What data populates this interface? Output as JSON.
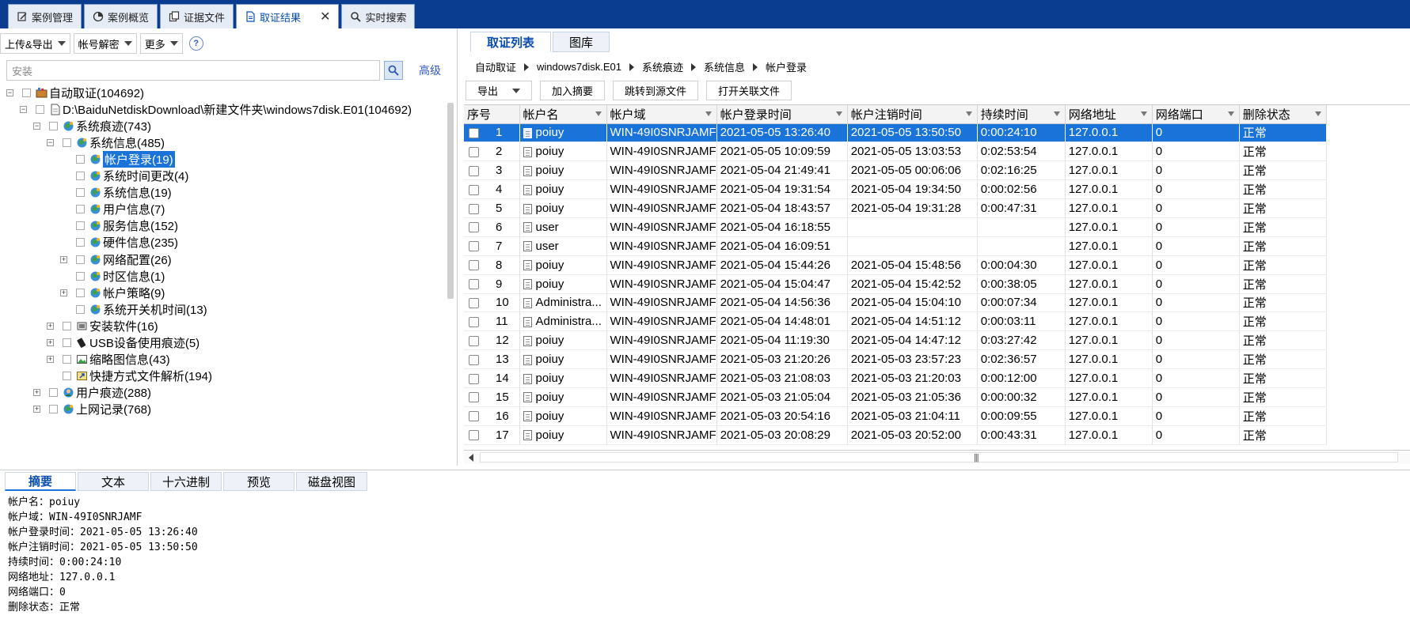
{
  "top_tabs": [
    {
      "label": "案例管理",
      "icon": "edit-icon"
    },
    {
      "label": "案例概览",
      "icon": "pie-chart-icon"
    },
    {
      "label": "证据文件",
      "icon": "copy-icon"
    },
    {
      "label": "取证结果",
      "icon": "document-icon",
      "active": true
    },
    {
      "label": "实时搜索",
      "icon": "search-icon"
    }
  ],
  "left_toolbar": {
    "upload_export": "上传&导出",
    "account_decrypt": "帐号解密",
    "more": "更多",
    "help": "?"
  },
  "search": {
    "placeholder": "安装",
    "advanced": "高级"
  },
  "tree": [
    {
      "label": "自动取证(104692)",
      "indent": 0,
      "exp": "-",
      "icon": "case-icon"
    },
    {
      "label": "D:\\BaiduNetdiskDownload\\新建文件夹\\windows7disk.E01(104692)",
      "indent": 1,
      "exp": "-",
      "icon": "file-icon"
    },
    {
      "label": "系统痕迹(743)",
      "indent": 2,
      "exp": "-",
      "icon": "globe-icon"
    },
    {
      "label": "系统信息(485)",
      "indent": 3,
      "exp": "-",
      "icon": "globe-icon"
    },
    {
      "label": "帐户登录(19)",
      "indent": 4,
      "exp": "",
      "icon": "globe-icon",
      "selected": true
    },
    {
      "label": "系统时间更改(4)",
      "indent": 4,
      "exp": "",
      "icon": "globe-icon"
    },
    {
      "label": "系统信息(19)",
      "indent": 4,
      "exp": "",
      "icon": "globe-icon"
    },
    {
      "label": "用户信息(7)",
      "indent": 4,
      "exp": "",
      "icon": "globe-icon"
    },
    {
      "label": "服务信息(152)",
      "indent": 4,
      "exp": "",
      "icon": "globe-icon"
    },
    {
      "label": "硬件信息(235)",
      "indent": 4,
      "exp": "",
      "icon": "globe-icon"
    },
    {
      "label": "网络配置(26)",
      "indent": 4,
      "exp": "+",
      "icon": "globe-icon"
    },
    {
      "label": "时区信息(1)",
      "indent": 4,
      "exp": "",
      "icon": "globe-icon"
    },
    {
      "label": "帐户策略(9)",
      "indent": 4,
      "exp": "+",
      "icon": "globe-icon"
    },
    {
      "label": "系统开关机时间(13)",
      "indent": 4,
      "exp": "",
      "icon": "globe-icon"
    },
    {
      "label": "安装软件(16)",
      "indent": 3,
      "exp": "+",
      "icon": "software-icon"
    },
    {
      "label": "USB设备使用痕迹(5)",
      "indent": 3,
      "exp": "+",
      "icon": "usb-icon"
    },
    {
      "label": "缩略图信息(43)",
      "indent": 3,
      "exp": "+",
      "icon": "image-icon"
    },
    {
      "label": "快捷方式文件解析(194)",
      "indent": 3,
      "exp": "",
      "icon": "shortcut-icon"
    },
    {
      "label": "用户痕迹(288)",
      "indent": 2,
      "exp": "+",
      "icon": "user-icon"
    },
    {
      "label": "上网记录(768)",
      "indent": 2,
      "exp": "+",
      "icon": "globe-icon"
    }
  ],
  "right_tabs": [
    {
      "label": "取证列表",
      "active": true
    },
    {
      "label": "图库"
    }
  ],
  "breadcrumb": [
    "自动取证",
    "windows7disk.E01",
    "系统痕迹",
    "系统信息",
    "帐户登录"
  ],
  "right_toolbar": {
    "export": "导出",
    "add_summary": "加入摘要",
    "jump_source": "跳转到源文件",
    "open_related": "打开关联文件"
  },
  "columns": [
    "序号",
    "帐户名",
    "帐户域",
    "帐户登录时间",
    "帐户注销时间",
    "持续时间",
    "网络地址",
    "网络端口",
    "删除状态"
  ],
  "rows": [
    [
      "1",
      "poiuy",
      "WIN-49I0SNRJAMF",
      "2021-05-05 13:26:40",
      "2021-05-05 13:50:50",
      "0:00:24:10",
      "127.0.0.1",
      "0",
      "正常"
    ],
    [
      "2",
      "poiuy",
      "WIN-49I0SNRJAMF",
      "2021-05-05 10:09:59",
      "2021-05-05 13:03:53",
      "0:02:53:54",
      "127.0.0.1",
      "0",
      "正常"
    ],
    [
      "3",
      "poiuy",
      "WIN-49I0SNRJAMF",
      "2021-05-04 21:49:41",
      "2021-05-05 00:06:06",
      "0:02:16:25",
      "127.0.0.1",
      "0",
      "正常"
    ],
    [
      "4",
      "poiuy",
      "WIN-49I0SNRJAMF",
      "2021-05-04 19:31:54",
      "2021-05-04 19:34:50",
      "0:00:02:56",
      "127.0.0.1",
      "0",
      "正常"
    ],
    [
      "5",
      "poiuy",
      "WIN-49I0SNRJAMF",
      "2021-05-04 18:43:57",
      "2021-05-04 19:31:28",
      "0:00:47:31",
      "127.0.0.1",
      "0",
      "正常"
    ],
    [
      "6",
      "user",
      "WIN-49I0SNRJAMF",
      "2021-05-04 16:18:55",
      "",
      "",
      "127.0.0.1",
      "0",
      "正常"
    ],
    [
      "7",
      "user",
      "WIN-49I0SNRJAMF",
      "2021-05-04 16:09:51",
      "",
      "",
      "127.0.0.1",
      "0",
      "正常"
    ],
    [
      "8",
      "poiuy",
      "WIN-49I0SNRJAMF",
      "2021-05-04 15:44:26",
      "2021-05-04 15:48:56",
      "0:00:04:30",
      "127.0.0.1",
      "0",
      "正常"
    ],
    [
      "9",
      "poiuy",
      "WIN-49I0SNRJAMF",
      "2021-05-04 15:04:47",
      "2021-05-04 15:42:52",
      "0:00:38:05",
      "127.0.0.1",
      "0",
      "正常"
    ],
    [
      "10",
      "Administra...",
      "WIN-49I0SNRJAMF",
      "2021-05-04 14:56:36",
      "2021-05-04 15:04:10",
      "0:00:07:34",
      "127.0.0.1",
      "0",
      "正常"
    ],
    [
      "11",
      "Administra...",
      "WIN-49I0SNRJAMF",
      "2021-05-04 14:48:01",
      "2021-05-04 14:51:12",
      "0:00:03:11",
      "127.0.0.1",
      "0",
      "正常"
    ],
    [
      "12",
      "poiuy",
      "WIN-49I0SNRJAMF",
      "2021-05-04 11:19:30",
      "2021-05-04 14:47:12",
      "0:03:27:42",
      "127.0.0.1",
      "0",
      "正常"
    ],
    [
      "13",
      "poiuy",
      "WIN-49I0SNRJAMF",
      "2021-05-03 21:20:26",
      "2021-05-03 23:57:23",
      "0:02:36:57",
      "127.0.0.1",
      "0",
      "正常"
    ],
    [
      "14",
      "poiuy",
      "WIN-49I0SNRJAMF",
      "2021-05-03 21:08:03",
      "2021-05-03 21:20:03",
      "0:00:12:00",
      "127.0.0.1",
      "0",
      "正常"
    ],
    [
      "15",
      "poiuy",
      "WIN-49I0SNRJAMF",
      "2021-05-03 21:05:04",
      "2021-05-03 21:05:36",
      "0:00:00:32",
      "127.0.0.1",
      "0",
      "正常"
    ],
    [
      "16",
      "poiuy",
      "WIN-49I0SNRJAMF",
      "2021-05-03 20:54:16",
      "2021-05-03 21:04:11",
      "0:00:09:55",
      "127.0.0.1",
      "0",
      "正常"
    ],
    [
      "17",
      "poiuy",
      "WIN-49I0SNRJAMF",
      "2021-05-03 20:08:29",
      "2021-05-03 20:52:00",
      "0:00:43:31",
      "127.0.0.1",
      "0",
      "正常"
    ]
  ],
  "selected_row": 0,
  "bottom_tabs": [
    {
      "label": "摘要",
      "active": true
    },
    {
      "label": "文本"
    },
    {
      "label": "十六进制"
    },
    {
      "label": "预览"
    },
    {
      "label": "磁盘视图"
    }
  ],
  "details": [
    "帐户名：poiuy",
    "帐户域：WIN-49I0SNRJAMF",
    "帐户登录时间：2021-05-05 13:26:40",
    "帐户注销时间：2021-05-05 13:50:50",
    "持续时间：0:00:24:10",
    "网络地址：127.0.0.1",
    "网络端口：0",
    "删除状态：正常"
  ],
  "colors": {
    "title_bar": "#0a3d8f",
    "selection": "#1a73d9",
    "link": "#2f5bb7"
  }
}
